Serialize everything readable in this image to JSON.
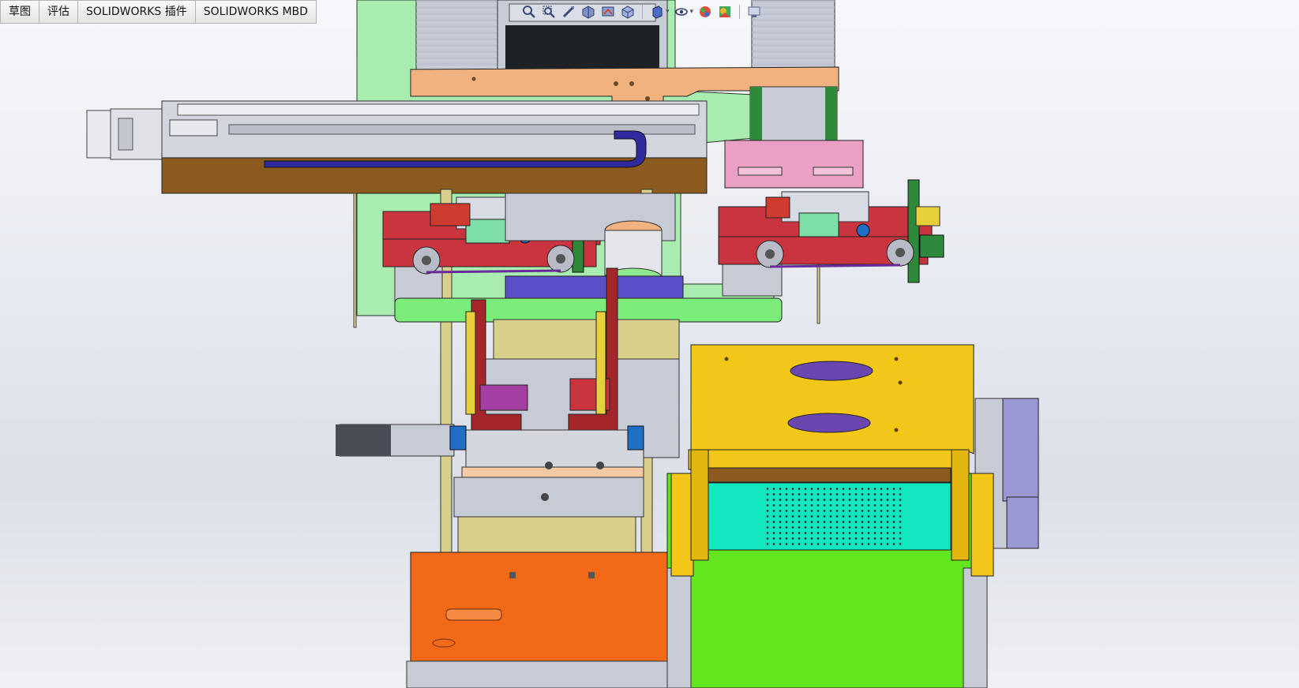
{
  "tabs": [
    {
      "label": "草图"
    },
    {
      "label": "评估"
    },
    {
      "label": "SOLIDWORKS 插件"
    },
    {
      "label": "SOLIDWORKS MBD"
    }
  ],
  "heads_up_toolbar": {
    "icons": [
      "zoom-to-fit-icon",
      "zoom-to-area-icon",
      "previous-view-icon",
      "section-view-icon",
      "dynamic-annotation-icon",
      "view-orientation-icon",
      "display-style-icon",
      "hide-show-items-icon",
      "edit-appearance-icon",
      "apply-scene-icon",
      "view-settings-icon"
    ]
  },
  "viewport": {
    "background_top": "#f7f8fb",
    "background_bottom": "#dcdfe7",
    "colors": {
      "olive": "#8b5a1e",
      "blue_rail": "#2f2a9e",
      "peach": "#f1b27f",
      "light_green": "#a9ecb0",
      "green": "#7ced7a",
      "red": "#c9343f",
      "pink": "#e9a0c4",
      "khaki": "#d8cf8a",
      "yellow": "#f3c718",
      "orange": "#f26a17",
      "lime": "#63e51e",
      "cyan": "#12e8c0",
      "purple": "#6a47b0",
      "lavender": "#9a98d3",
      "steel": "#c7cbd6"
    }
  }
}
